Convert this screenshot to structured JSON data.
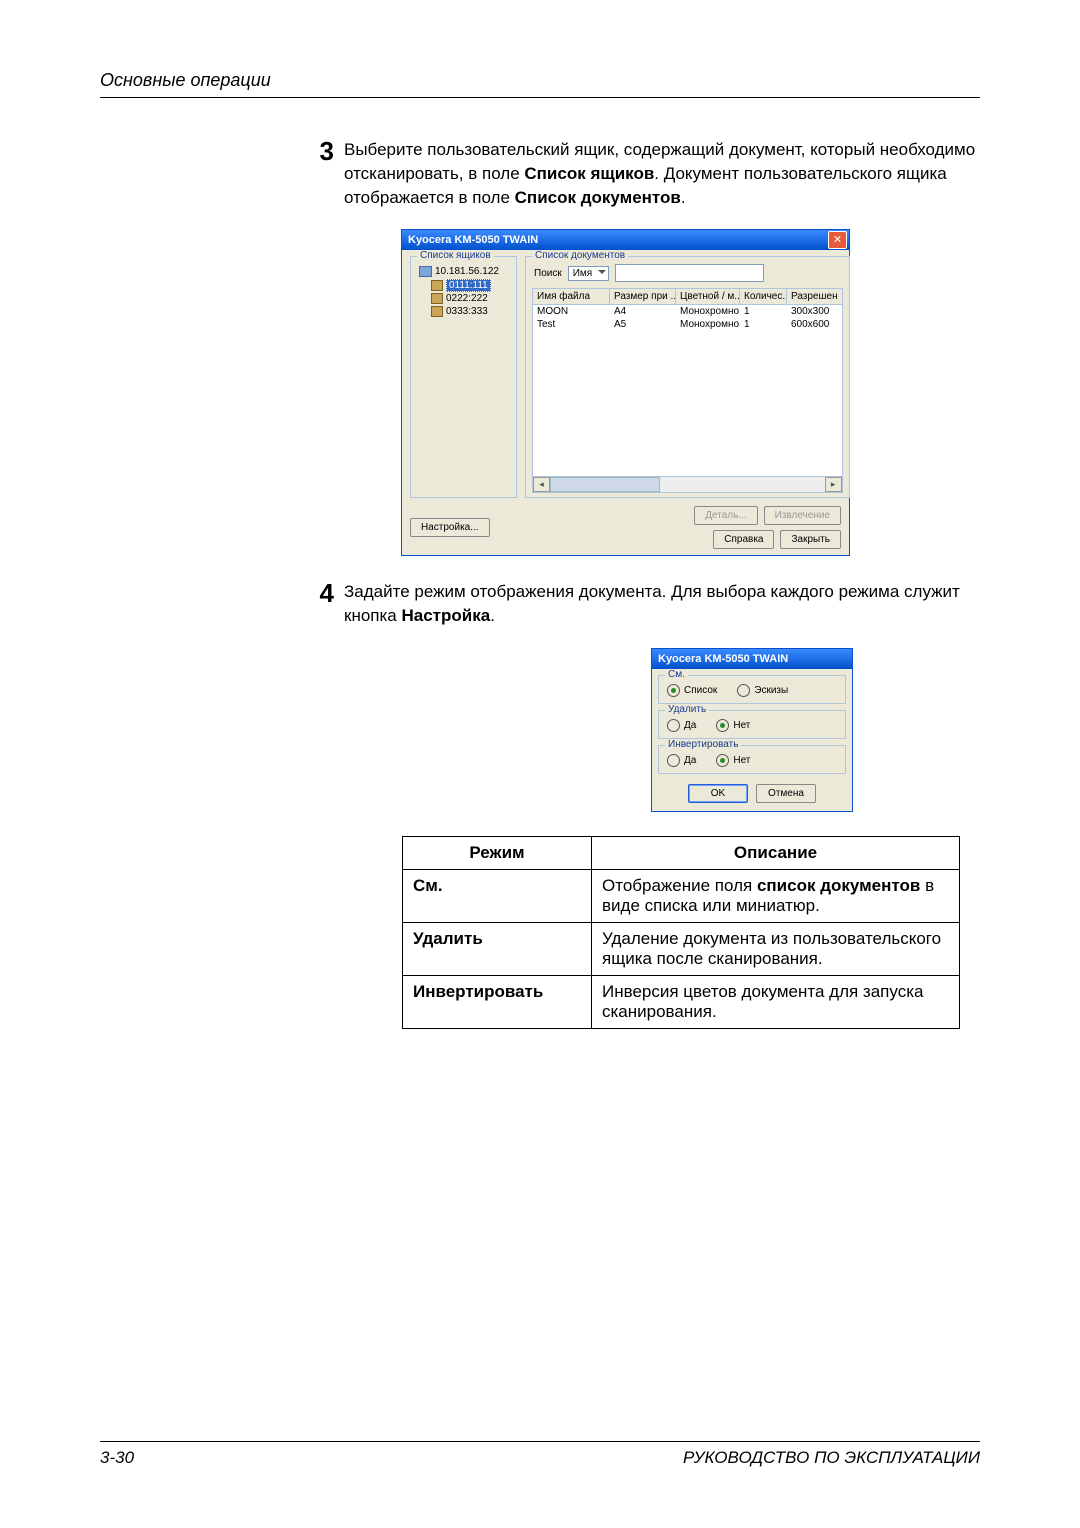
{
  "page_header": "Основные операции",
  "step3_num": "3",
  "step3_text_before": "Выберите пользовательский ящик, содержащий документ, который необходимо отсканировать, в поле ",
  "step3_bold1": "Список ящиков",
  "step3_text_mid": ". Документ пользовательского ящика отображается в поле ",
  "step3_bold2": "Список документов",
  "step3_text_after": ".",
  "dlg1": {
    "title": "Kyocera KM-5050 TWAIN",
    "boxes_legend": "Список ящиков",
    "tree_root": "10.181.56.122",
    "tree_items": [
      "0111:111",
      "0222:222",
      "0333:333"
    ],
    "docs_legend": "Список документов",
    "search_label": "Поиск",
    "search_mode": "Имя",
    "columns": [
      "Имя файла",
      "Размер при ...",
      "Цветной / м...",
      "Количес...",
      "Разрешен"
    ],
    "rows": [
      {
        "c1": "MOON",
        "c2": "A4",
        "c3": "Монохромно...",
        "c4": "1",
        "c5": "300x300"
      },
      {
        "c1": "Test",
        "c2": "A5",
        "c3": "Монохромно...",
        "c4": "1",
        "c5": "600x600"
      }
    ],
    "btn_settings": "Настройка...",
    "btn_detail": "Деталь...",
    "btn_extract": "Извлечение",
    "btn_help": "Справка",
    "btn_close": "Закрыть"
  },
  "step4_num": "4",
  "step4_text_before": "Задайте режим отображения документа. Для выбора каждого режима служит кнопка ",
  "step4_bold": "Настройка",
  "step4_text_after": ".",
  "dlg2": {
    "title": "Kyocera KM-5050 TWAIN",
    "view": {
      "legend": "См.",
      "opt1": "Список",
      "opt2": "Эскизы"
    },
    "delete": {
      "legend": "Удалить",
      "opt1": "Да",
      "opt2": "Нет"
    },
    "invert": {
      "legend": "Инвертировать",
      "opt1": "Да",
      "opt2": "Нет"
    },
    "ok": "OK",
    "cancel": "Отмена"
  },
  "modes_table": {
    "head_mode": "Режим",
    "head_desc": "Описание",
    "rows": [
      {
        "mode": "См.",
        "desc_pre": "Отображение поля ",
        "desc_bold": "список документов",
        "desc_post": " в виде списка или миниатюр."
      },
      {
        "mode": "Удалить",
        "desc_pre": "Удаление документа из пользовательского ящика после сканирования.",
        "desc_bold": "",
        "desc_post": ""
      },
      {
        "mode": "Инвертировать",
        "desc_pre": "Инверсия цветов документа для запуска сканирования.",
        "desc_bold": "",
        "desc_post": ""
      }
    ]
  },
  "footer_left": "3-30",
  "footer_right": "РУКОВОДСТВО ПО ЭКСПЛУАТАЦИИ"
}
